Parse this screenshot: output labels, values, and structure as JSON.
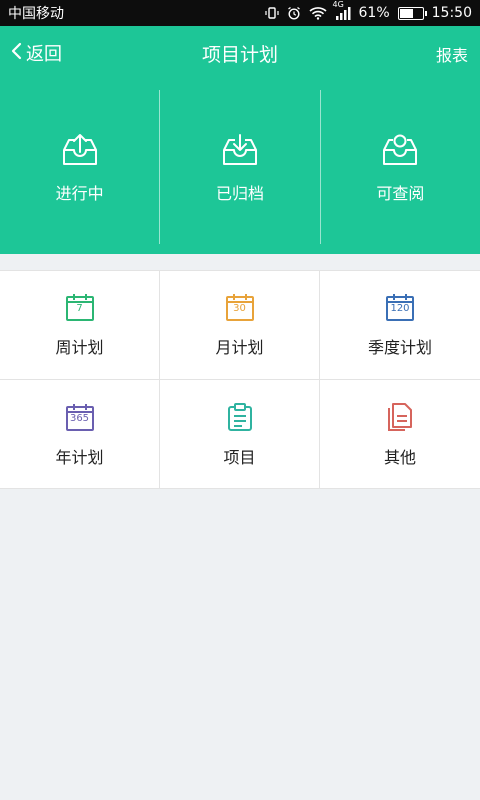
{
  "status_bar": {
    "carrier": "中国移动",
    "network": "4G",
    "battery": "61%",
    "time": "15:50"
  },
  "nav": {
    "back_label": "返回",
    "title": "项目计划",
    "report_label": "报表"
  },
  "tabs": [
    {
      "label": "进行中",
      "icon": "inbox-upload-icon"
    },
    {
      "label": "已归档",
      "icon": "inbox-download-icon"
    },
    {
      "label": "可查阅",
      "icon": "inbox-view-icon"
    }
  ],
  "grid": [
    {
      "label": "周计划",
      "icon": "calendar-icon",
      "number": "7",
      "color": "#2bb673"
    },
    {
      "label": "月计划",
      "icon": "calendar-icon",
      "number": "30",
      "color": "#e8a33a"
    },
    {
      "label": "季度计划",
      "icon": "calendar-icon",
      "number": "120",
      "color": "#3a6fb5"
    },
    {
      "label": "年计划",
      "icon": "calendar-icon",
      "number": "365",
      "color": "#6a5fb0"
    },
    {
      "label": "项目",
      "icon": "clipboard-icon",
      "color": "#2fb3a0"
    },
    {
      "label": "其他",
      "icon": "document-icon",
      "color": "#d6645c"
    }
  ]
}
